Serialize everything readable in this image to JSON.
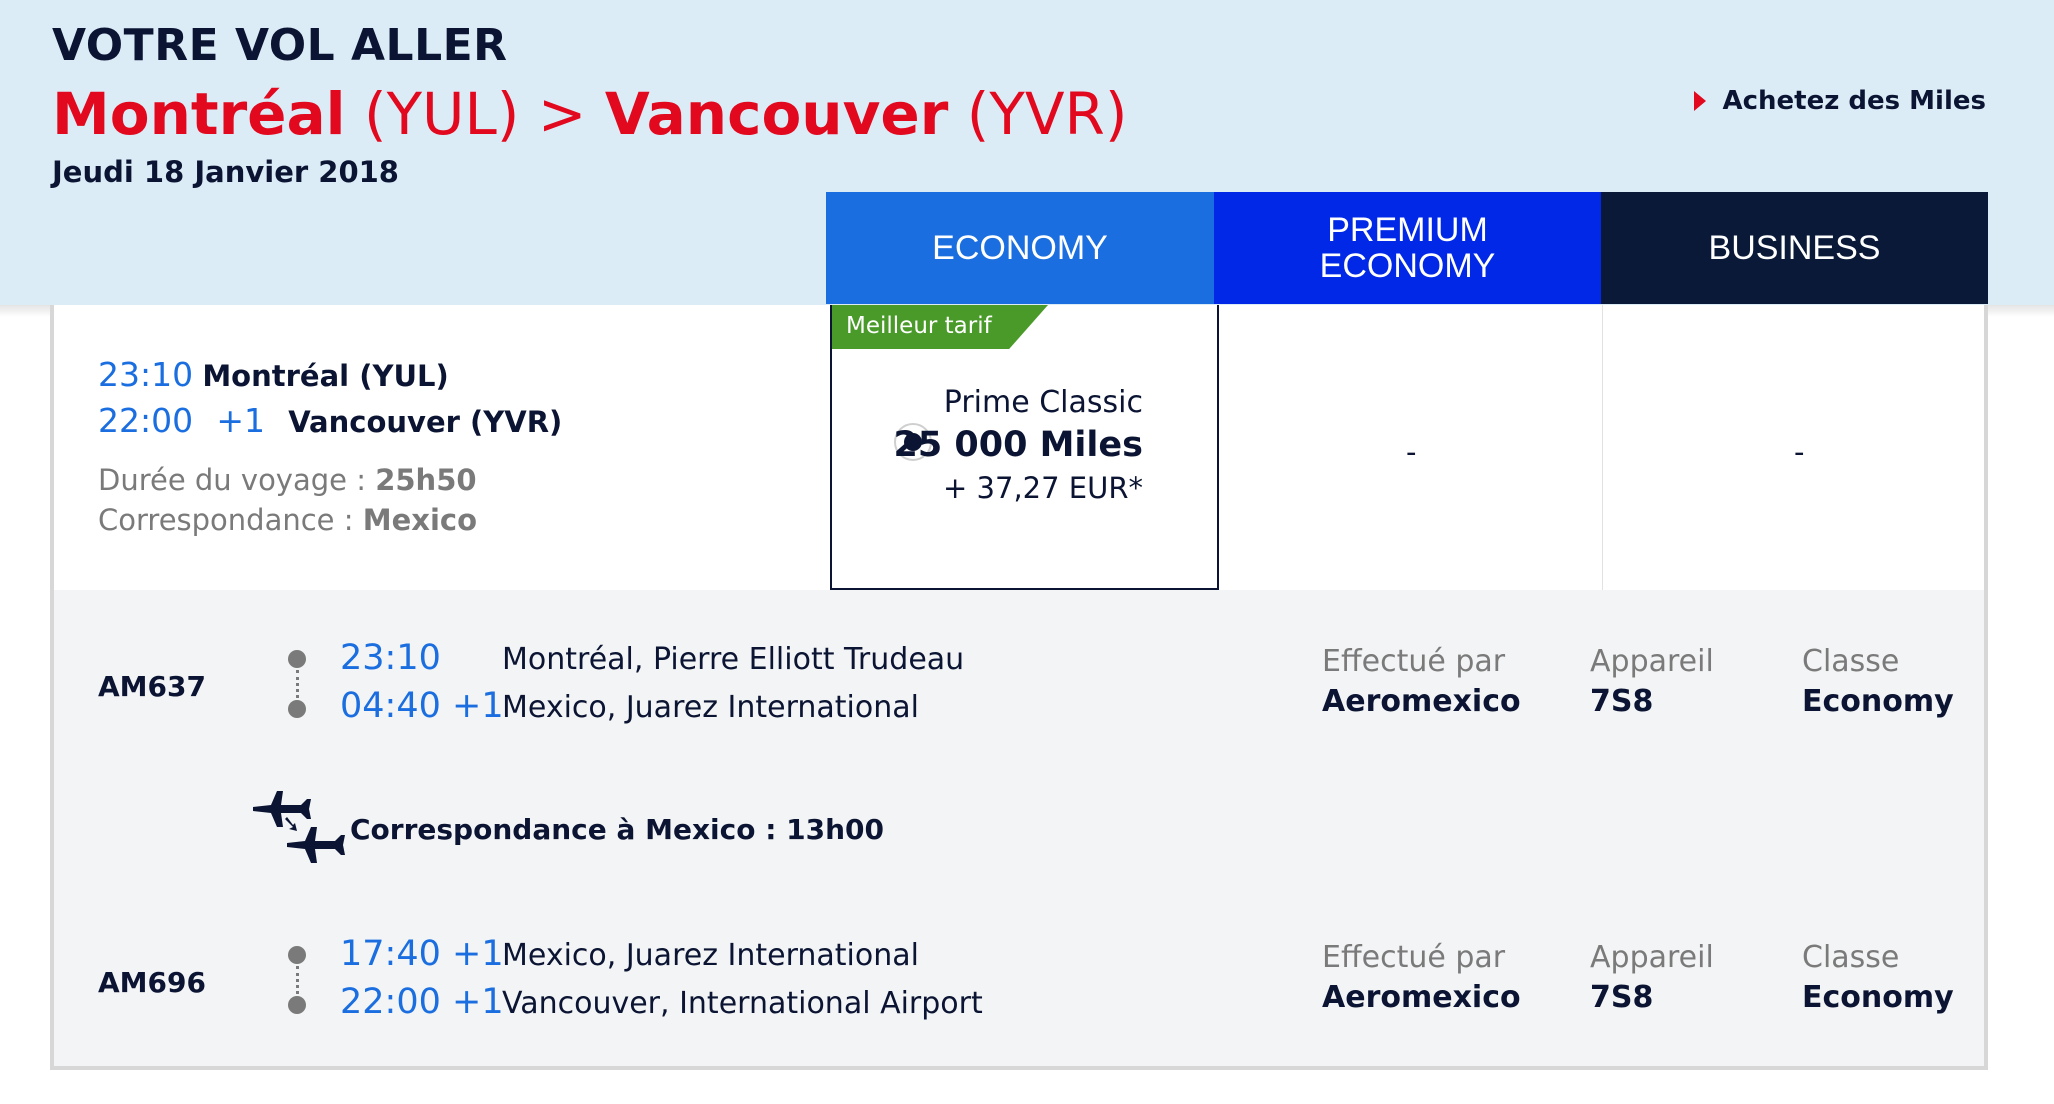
{
  "header": {
    "title": "VOTRE VOL ALLER",
    "origin_city": "Montréal",
    "origin_code": "(YUL)",
    "separator": ">",
    "dest_city": "Vancouver",
    "dest_code": "(YVR)",
    "date": "Jeudi 18 Janvier 2018",
    "buy_miles_label": "Achetez des Miles"
  },
  "cabins": {
    "economy": "ECONOMY",
    "premium_line1": "PREMIUM",
    "premium_line2": "ECONOMY",
    "business": "BUSINESS"
  },
  "summary": {
    "dep_time": "23:10",
    "dep_place": "Montréal (YUL)",
    "arr_time": "22:00",
    "arr_offset": "+1",
    "arr_place": "Vancouver (YVR)",
    "duration_label": "Durée du voyage :",
    "duration_value": "25h50",
    "connection_label": "Correspondance :",
    "connection_value": "Mexico"
  },
  "fare": {
    "best_tag": "Meilleur tarif",
    "name": "Prime Classic",
    "miles": "25 000 Miles",
    "tax": "+ 37,27 EUR*",
    "premium_value": "-",
    "business_value": "-"
  },
  "segments": [
    {
      "flight": "AM637",
      "dep_time": "23:10",
      "dep_place": "Montréal, Pierre Elliott Trudeau",
      "arr_time": "04:40 +1",
      "arr_place": "Mexico, Juarez International",
      "operated_label": "Effectué par",
      "operated_value": "Aeromexico",
      "aircraft_label": "Appareil",
      "aircraft_value": "7S8",
      "class_label": "Classe",
      "class_value": "Economy"
    },
    {
      "flight": "AM696",
      "dep_time": "17:40 +1",
      "dep_place": "Mexico, Juarez International",
      "arr_time": "22:00 +1",
      "arr_place": "Vancouver, International Airport",
      "operated_label": "Effectué par",
      "operated_value": "Aeromexico",
      "aircraft_label": "Appareil",
      "aircraft_value": "7S8",
      "class_label": "Classe",
      "class_value": "Economy"
    }
  ],
  "connection": {
    "text": "Correspondance à Mexico : 13h00",
    "icon": "connecting-planes-icon"
  },
  "colors": {
    "brand_red": "#e2091e",
    "economy_blue": "#1a6ee0",
    "premium_blue": "#0028e6",
    "business_navy": "#0a1938",
    "best_green": "#4a9a2a"
  }
}
